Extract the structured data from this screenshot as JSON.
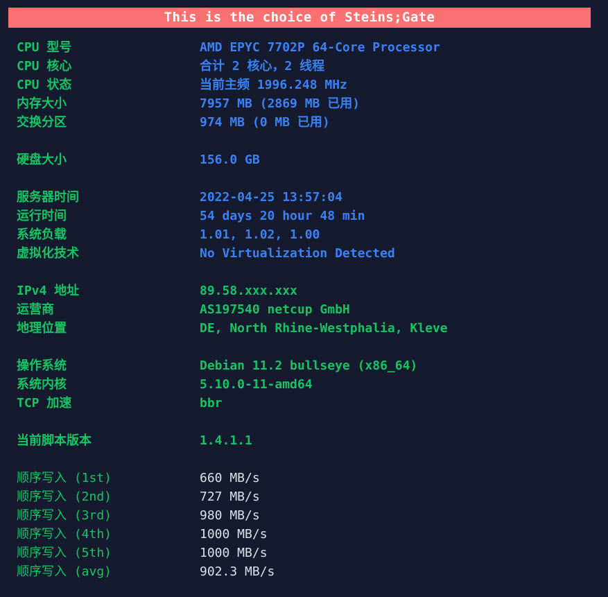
{
  "banner": {
    "text": "This is the choice of Steins;Gate",
    "background_color": "#fb7171",
    "text_color": "#ffffff"
  },
  "theme": {
    "background_color": "#151a2e",
    "label_color": "#16c464",
    "value_blue": "#3b82f6",
    "value_green": "#16c464",
    "value_white": "#dde1e6"
  },
  "rows": [
    {
      "label": "CPU 型号",
      "value": "AMD EPYC 7702P 64-Core Processor",
      "label_style": "c-green",
      "value_style": "c-blue"
    },
    {
      "label": "CPU 核心",
      "value": "合计 2 核心，2 线程",
      "label_style": "c-green",
      "value_style": "c-blue"
    },
    {
      "label": "CPU 状态",
      "value": "当前主频 1996.248 MHz",
      "label_style": "c-green",
      "value_style": "c-blue"
    },
    {
      "label": "内存大小",
      "value": "7957 MB (2869 MB 已用)",
      "label_style": "c-green",
      "value_style": "c-blue"
    },
    {
      "label": "交换分区",
      "value": "974 MB (0 MB 已用)",
      "label_style": "c-green",
      "value_style": "c-blue"
    },
    {
      "spacer": true
    },
    {
      "label": "硬盘大小",
      "value": "156.0 GB",
      "label_style": "c-green",
      "value_style": "c-blue"
    },
    {
      "spacer": true
    },
    {
      "label": "服务器时间",
      "value": "2022-04-25 13:57:04",
      "label_style": "c-green",
      "value_style": "c-blue"
    },
    {
      "label": "运行时间",
      "value": "54 days 20 hour 48 min",
      "label_style": "c-green",
      "value_style": "c-blue"
    },
    {
      "label": "系统负载",
      "value": "1.01, 1.02, 1.00",
      "label_style": "c-green",
      "value_style": "c-blue"
    },
    {
      "label": "虚拟化技术",
      "value": "No Virtualization Detected",
      "label_style": "c-green",
      "value_style": "c-blue"
    },
    {
      "spacer": true
    },
    {
      "label": "IPv4 地址",
      "value": "89.58.xxx.xxx",
      "label_style": "c-green",
      "value_style": "c-green"
    },
    {
      "label": "运营商",
      "value": "AS197540 netcup GmbH",
      "label_style": "c-green",
      "value_style": "c-green"
    },
    {
      "label": "地理位置",
      "value": "DE, North Rhine-Westphalia, Kleve",
      "label_style": "c-green",
      "value_style": "c-green"
    },
    {
      "spacer": true
    },
    {
      "label": "操作系统",
      "value": "Debian 11.2 bullseye (x86_64)",
      "label_style": "c-green",
      "value_style": "c-green"
    },
    {
      "label": "系统内核",
      "value": "5.10.0-11-amd64",
      "label_style": "c-green",
      "value_style": "c-green"
    },
    {
      "label": "TCP 加速",
      "value": "bbr",
      "label_style": "c-green",
      "value_style": "c-green"
    },
    {
      "spacer": true
    },
    {
      "label": "当前脚本版本",
      "value": "1.4.1.1",
      "label_style": "c-green",
      "value_style": "c-green"
    },
    {
      "spacer": true
    },
    {
      "label": "顺序写入 (1st)",
      "value": "660 MB/s",
      "label_style": "c-green-plain",
      "value_style": "c-white"
    },
    {
      "label": "顺序写入 (2nd)",
      "value": "727 MB/s",
      "label_style": "c-green-plain",
      "value_style": "c-white"
    },
    {
      "label": "顺序写入 (3rd)",
      "value": "980 MB/s",
      "label_style": "c-green-plain",
      "value_style": "c-white"
    },
    {
      "label": "顺序写入 (4th)",
      "value": "1000 MB/s",
      "label_style": "c-green-plain",
      "value_style": "c-white"
    },
    {
      "label": "顺序写入 (5th)",
      "value": "1000 MB/s",
      "label_style": "c-green-plain",
      "value_style": "c-white"
    },
    {
      "label": "顺序写入 (avg)",
      "value": "902.3 MB/s",
      "label_style": "c-green-plain",
      "value_style": "c-white"
    }
  ]
}
